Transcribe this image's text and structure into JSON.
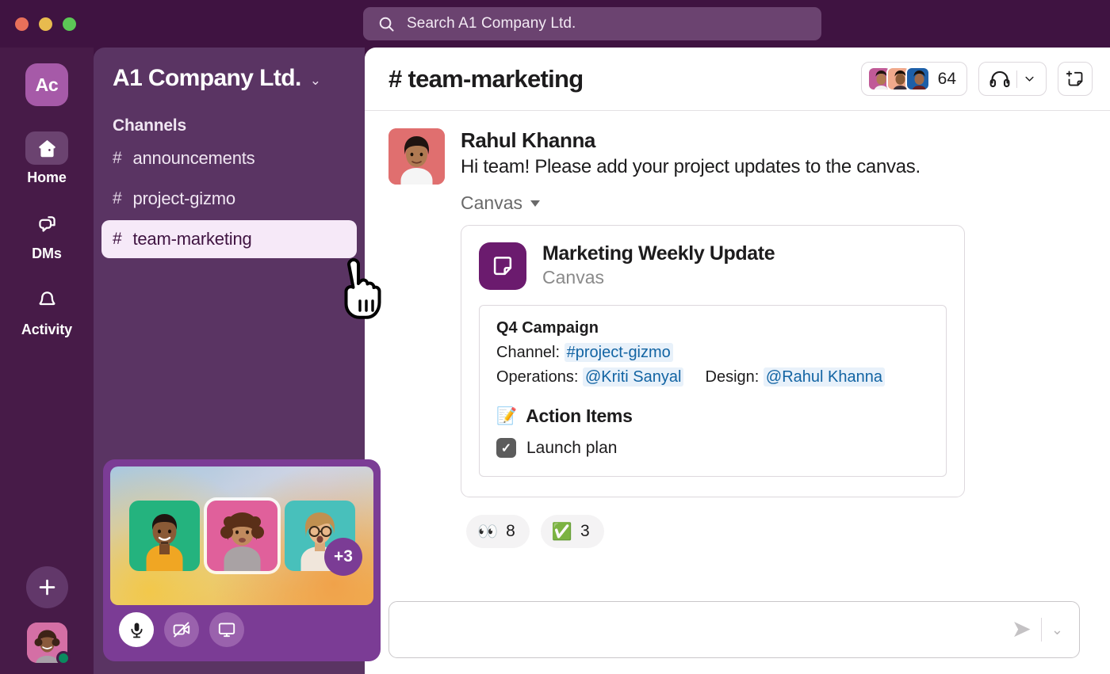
{
  "window": {
    "traffic_lights": [
      "close",
      "minimize",
      "zoom"
    ]
  },
  "search": {
    "placeholder": "Search A1 Company Ltd.",
    "icon": "search-icon"
  },
  "rail": {
    "workspace_initials": "Ac",
    "items": [
      {
        "label": "Home",
        "icon": "home-icon",
        "active": true
      },
      {
        "label": "DMs",
        "icon": "dms-icon",
        "active": false
      },
      {
        "label": "Activity",
        "icon": "bell-icon",
        "active": false
      }
    ],
    "add_button_icon": "plus-icon",
    "user_avatar": "user-avatar",
    "presence": "online"
  },
  "sidebar": {
    "workspace_name": "A1 Company Ltd.",
    "workspace_chevron": "chevron-down-icon",
    "section_title": "Channels",
    "channels": [
      {
        "name": "announcements",
        "prefix": "#",
        "active": false
      },
      {
        "name": "project-gizmo",
        "prefix": "#",
        "active": false
      },
      {
        "name": "team-marketing",
        "prefix": "#",
        "active": true
      }
    ]
  },
  "huddle": {
    "overflow_count": "+3",
    "participants": [
      "participant-1",
      "participant-2",
      "participant-3"
    ],
    "controls": [
      {
        "name": "mic",
        "icon": "microphone-icon",
        "active": true
      },
      {
        "name": "video",
        "icon": "video-off-icon",
        "active": false
      },
      {
        "name": "screen-share",
        "icon": "monitor-icon",
        "active": false
      }
    ]
  },
  "channel": {
    "prefix": "#",
    "name": "team-marketing",
    "member_count": "64",
    "huddle_icon": "headphones-icon",
    "huddle_chevron": "chevron-down-icon",
    "new_canvas_icon": "new-canvas-icon"
  },
  "message": {
    "author": "Rahul Khanna",
    "text": "Hi team! Please add your project updates to the canvas.",
    "attachment_label": "Canvas",
    "canvas": {
      "title": "Marketing Weekly Update",
      "subtitle": "Canvas",
      "icon": "canvas-icon",
      "section_heading": "Q4 Campaign",
      "channel_label": "Channel:",
      "channel_mention": "#project-gizmo",
      "operations_label": "Operations:",
      "operations_mention": "@Kriti Sanyal",
      "design_label": "Design:",
      "design_mention": "@Rahul Khanna",
      "action_items_emoji": "📝",
      "action_items_title": "Action Items",
      "todos": [
        {
          "label": "Launch plan",
          "checked": true
        }
      ]
    }
  },
  "reactions": [
    {
      "emoji": "👀",
      "count": "8"
    },
    {
      "emoji": "✅",
      "count": "3"
    }
  ],
  "composer": {
    "value": "",
    "placeholder": "",
    "send_icon": "send-icon",
    "send_chevron": "chevron-down-icon"
  },
  "colors": {
    "rail_bg": "#471b48",
    "sidebar_bg": "#5a3463",
    "topbar_bg": "#3f1341",
    "active_channel_bg": "#f6e9f8",
    "canvas_icon_bg": "#6b1b6e",
    "mention_blue": "#1264a3",
    "huddle_bg": "#7b3c95"
  }
}
